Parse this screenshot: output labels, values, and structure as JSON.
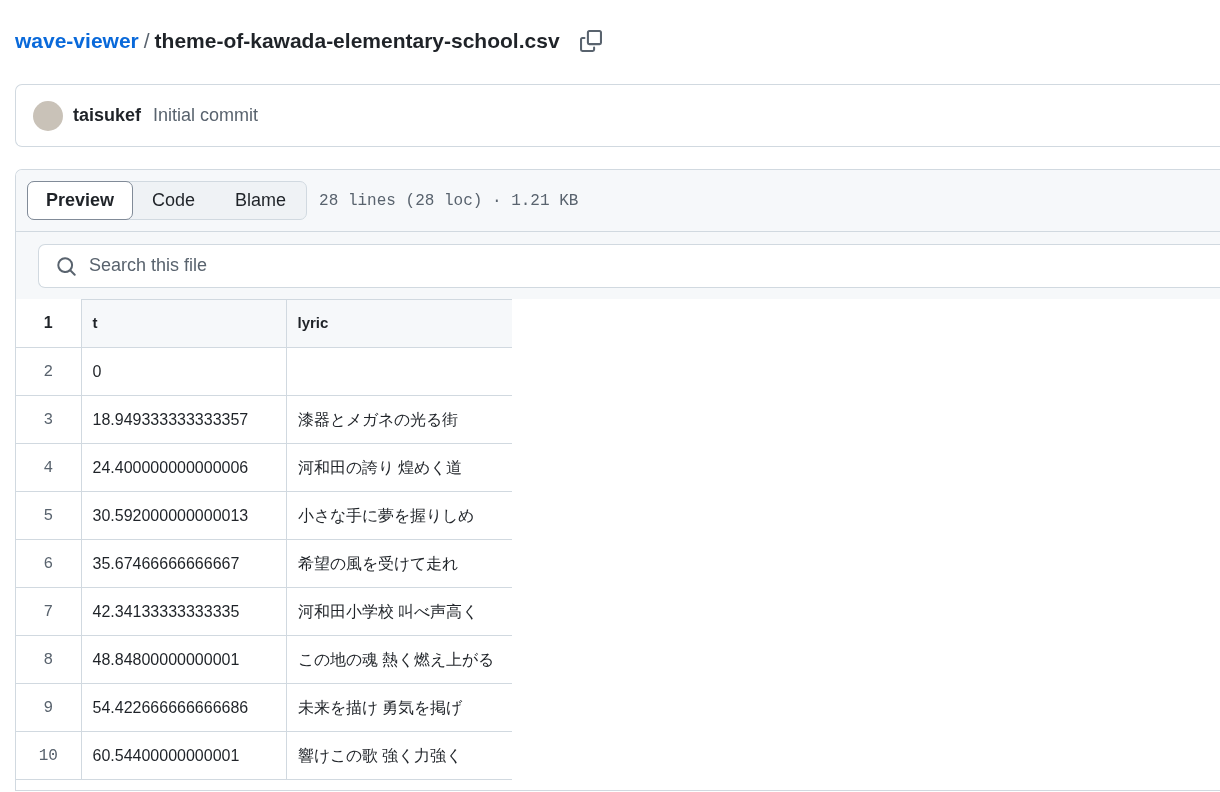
{
  "breadcrumb": {
    "repo": "wave-viewer",
    "separator": "/",
    "file": "theme-of-kawada-elementary-school.csv"
  },
  "commit": {
    "author": "taisukef",
    "message": "Initial commit"
  },
  "tabs": [
    {
      "label": "Preview",
      "selected": true
    },
    {
      "label": "Code",
      "selected": false
    },
    {
      "label": "Blame",
      "selected": false
    }
  ],
  "file_info": "28 lines (28 loc) · 1.21 KB",
  "search": {
    "placeholder": "Search this file"
  },
  "table": {
    "header": {
      "line": "1",
      "cells": [
        "t",
        "lyric"
      ]
    },
    "rows": [
      {
        "line": "2",
        "cells": [
          "0",
          ""
        ]
      },
      {
        "line": "3",
        "cells": [
          "18.949333333333357",
          "漆器とメガネの光る街"
        ]
      },
      {
        "line": "4",
        "cells": [
          "24.400000000000006",
          "河和田の誇り 煌めく道"
        ]
      },
      {
        "line": "5",
        "cells": [
          "30.592000000000013",
          "小さな手に夢を握りしめ"
        ]
      },
      {
        "line": "6",
        "cells": [
          "35.67466666666667",
          "希望の風を受けて走れ"
        ]
      },
      {
        "line": "7",
        "cells": [
          "42.34133333333335",
          "河和田小学校 叫べ声高く"
        ]
      },
      {
        "line": "8",
        "cells": [
          "48.84800000000001",
          "この地の魂 熱く燃え上がる"
        ]
      },
      {
        "line": "9",
        "cells": [
          "54.422666666666686",
          "未来を描け 勇気を掲げ"
        ]
      },
      {
        "line": "10",
        "cells": [
          "60.54400000000001",
          "響けこの歌 強く力強く"
        ]
      }
    ]
  }
}
